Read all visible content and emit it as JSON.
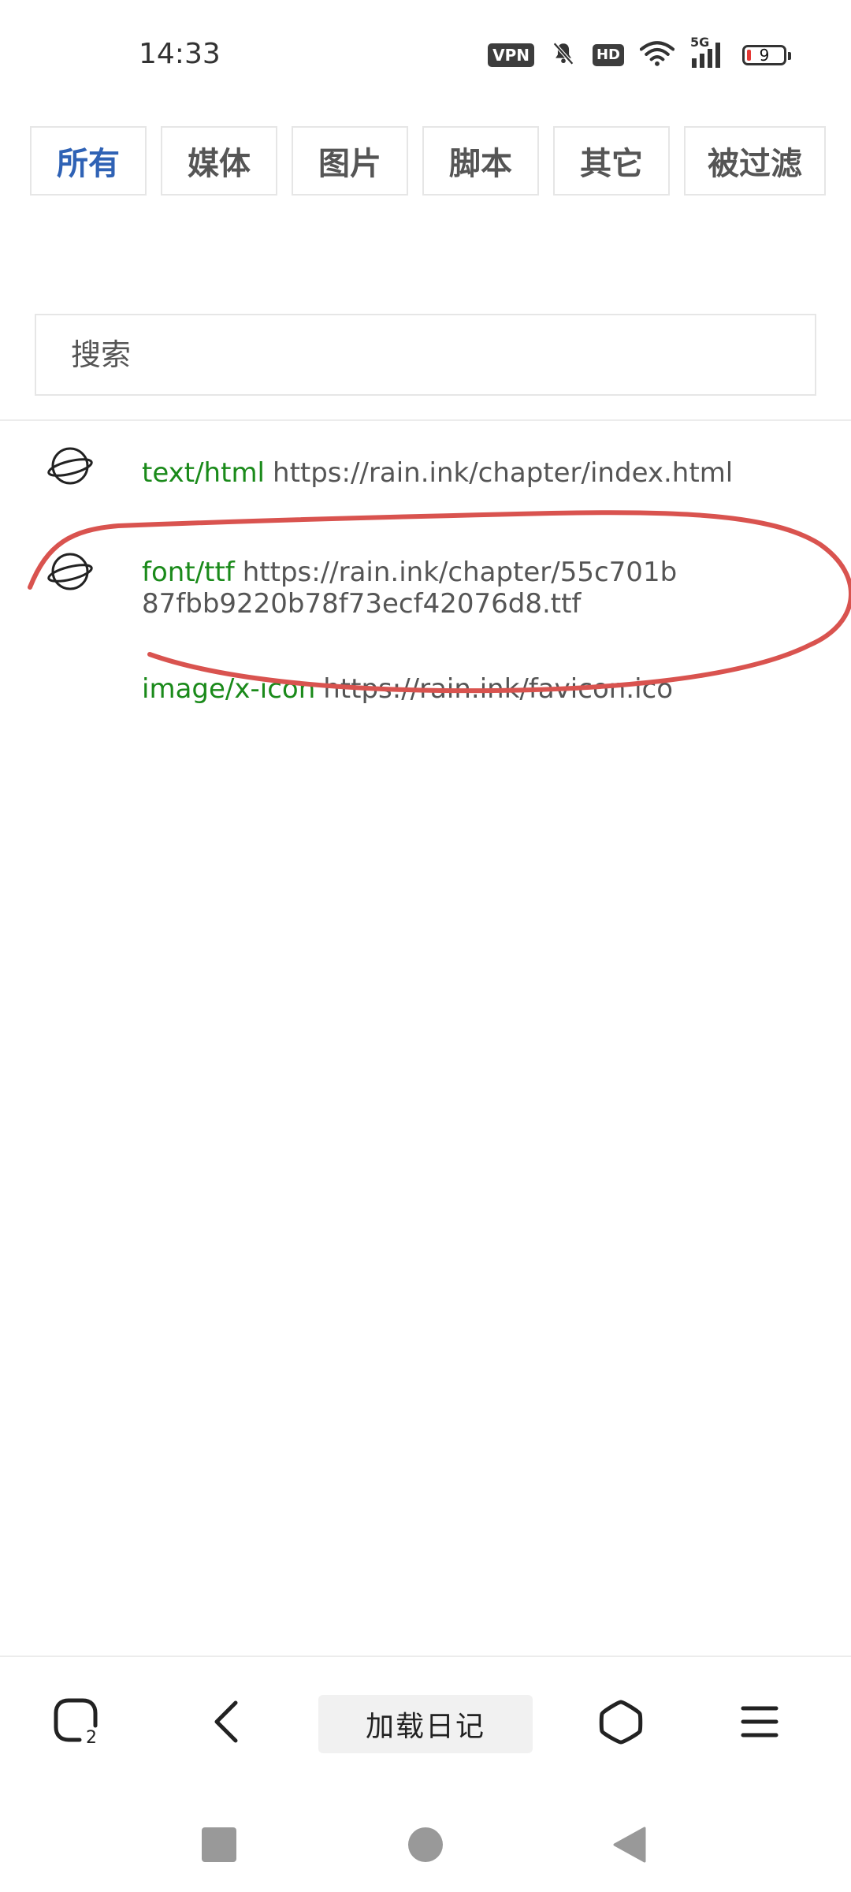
{
  "status_bar": {
    "time": "14:33",
    "vpn": "VPN",
    "hd": "HD",
    "network": "5G",
    "battery": "9"
  },
  "filters": [
    {
      "label": "所有",
      "active": true
    },
    {
      "label": "媒体",
      "active": false
    },
    {
      "label": "图片",
      "active": false
    },
    {
      "label": "脚本",
      "active": false
    },
    {
      "label": "其它",
      "active": false
    },
    {
      "label": "被过滤",
      "active": false
    }
  ],
  "search": {
    "placeholder": "搜索"
  },
  "logs": [
    {
      "type": "text/html",
      "url": "https://rain.ink/chapter/index.html",
      "icon": "planet-icon"
    },
    {
      "type": "font/ttf",
      "url": "https://rain.ink/chapter/55c701b87fbb9220b78f73ecf42076d8.ttf",
      "icon": "planet-icon"
    },
    {
      "type": "image/x-icon",
      "url": "https://rain.ink/favicon.ico",
      "icon": "none"
    }
  ],
  "toolbar": {
    "tabs_count": "2",
    "title": "加载日记"
  },
  "colors": {
    "active_tab": "#2f62b5",
    "mime_type": "#1a8a1a",
    "annotation": "#d9534f"
  }
}
